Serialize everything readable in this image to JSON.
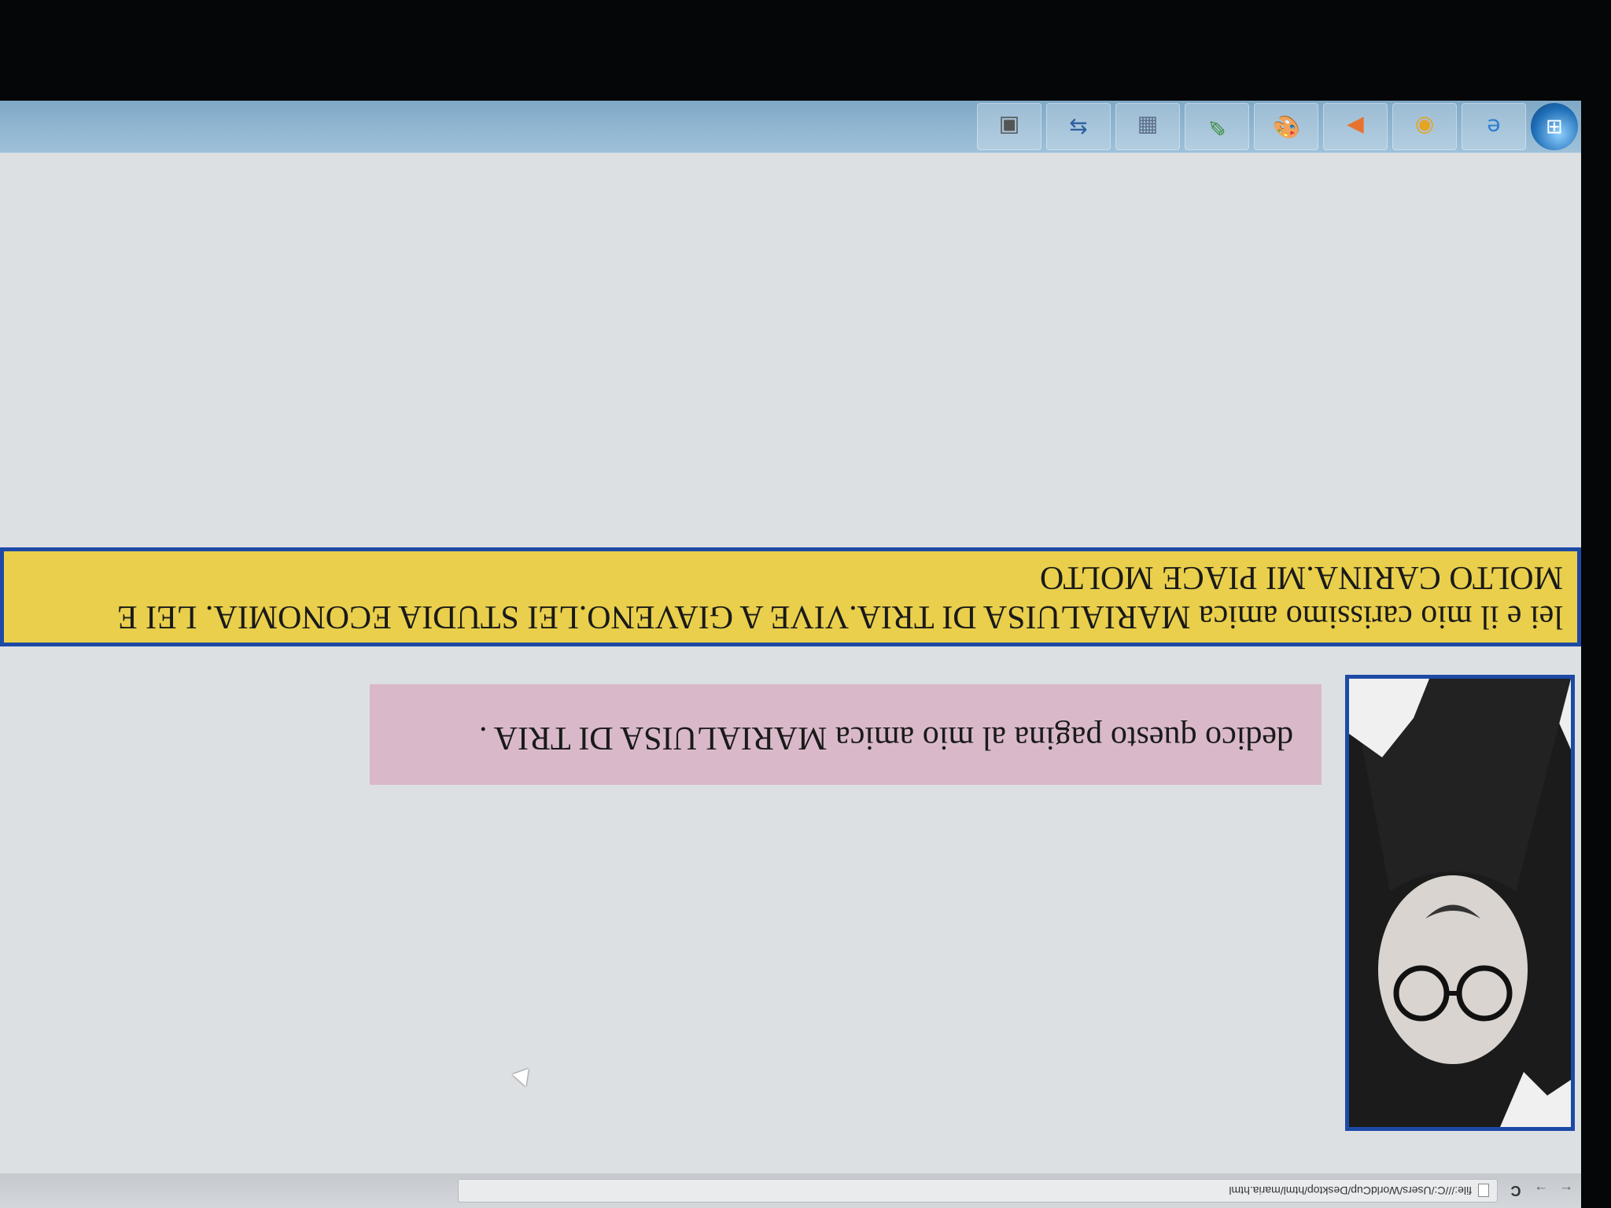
{
  "browser": {
    "back_glyph": "←",
    "forward_glyph": "→",
    "reload_glyph": "C",
    "url": "file:///C:/Users/WorldCup/Desktop/html/maria.html"
  },
  "page": {
    "dedication": "dedico questo pagina al mio amica MARIALUISA DI TRIA .",
    "description": "lei e il mio carissimo amica MARIALUISA DI TRIA.VIVE A GIAVENO.LEI STUDIA ECONOMIA. LEI E MOLTO CARINA.MI PIACE MOLTO"
  },
  "taskbar": {
    "items": [
      {
        "name": "internet-explorer-icon",
        "glyph": "e",
        "color": "#2d7fd3"
      },
      {
        "name": "chrome-icon",
        "glyph": "◉",
        "color": "#e5a423"
      },
      {
        "name": "media-player-icon",
        "glyph": "▶",
        "color": "#e8732f"
      },
      {
        "name": "paint-icon",
        "glyph": "🎨",
        "color": "#d8412f"
      },
      {
        "name": "notepad-plus-icon",
        "glyph": "✎",
        "color": "#3b8c3b"
      },
      {
        "name": "calculator-icon",
        "glyph": "▦",
        "color": "#5d6f8c"
      },
      {
        "name": "network-icon",
        "glyph": "⇆",
        "color": "#2f5f9f"
      },
      {
        "name": "image-file-icon",
        "glyph": "▣",
        "color": "#555555"
      }
    ]
  }
}
